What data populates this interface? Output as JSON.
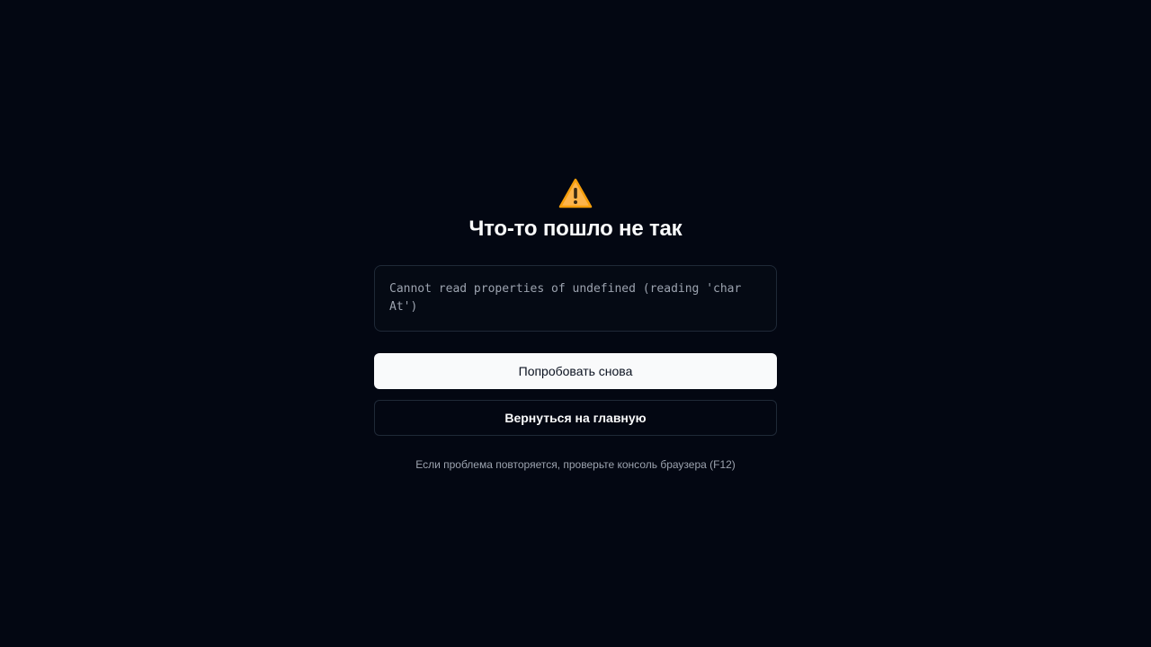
{
  "error_page": {
    "icon": "warning-icon",
    "title": "Что-то пошло не так",
    "error_message": "Cannot read properties of undefined (reading 'charAt')",
    "retry_label": "Попробовать снова",
    "home_label": "Вернуться на главную",
    "hint": "Если проблема повторяется, проверьте консоль браузера (F12)"
  },
  "colors": {
    "background": "#030712",
    "warning_fill": "#FDB44B",
    "primary_button_bg": "#F9FAFB",
    "border": "#1F2937",
    "muted_text": "#9CA3AF"
  }
}
